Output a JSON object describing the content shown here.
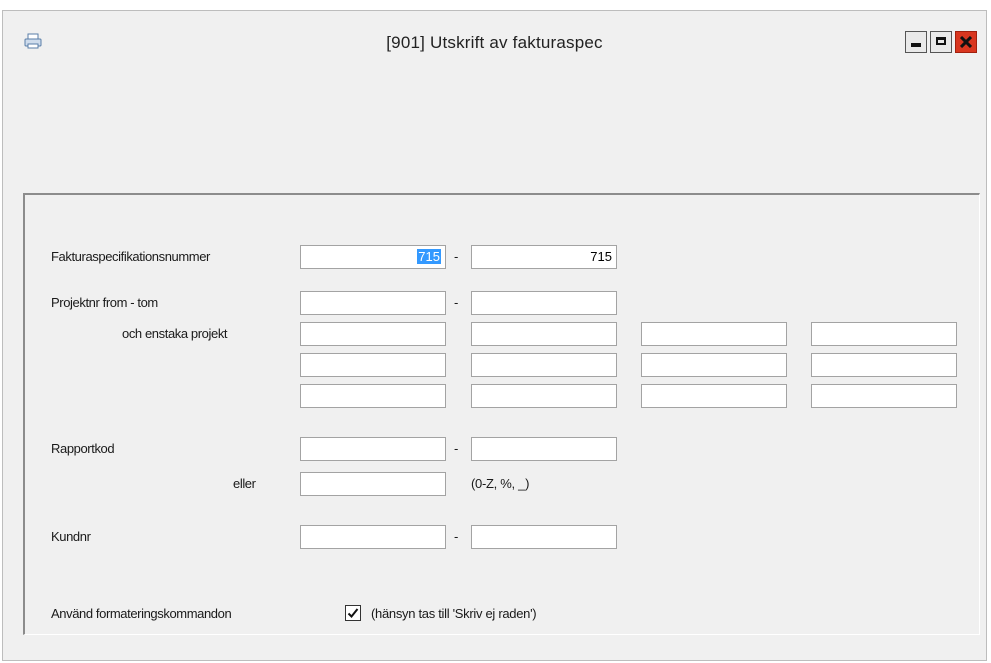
{
  "window": {
    "title": "[901]  Utskrift av fakturaspec",
    "app_icon": "printer-icon",
    "controls": [
      "minimize-icon",
      "maximize-icon",
      "close-icon"
    ]
  },
  "form": {
    "fakturaspec": {
      "label": "Fakturaspecifikationsnummer",
      "from": "715",
      "to": "715",
      "separator": "-"
    },
    "projektnr": {
      "label": "Projektnr from - tom",
      "from": "",
      "to": "",
      "separator": "-"
    },
    "enstaka": {
      "label": "och enstaka projekt",
      "fields": [
        "",
        "",
        "",
        "",
        "",
        "",
        "",
        "",
        "",
        "",
        "",
        ""
      ]
    },
    "rapportkod": {
      "label": "Rapportkod",
      "from": "",
      "to": "",
      "separator": "-",
      "or_label": "eller",
      "or_value": "",
      "hint": "(0-Z, %, _)"
    },
    "kundnr": {
      "label": "Kundnr",
      "from": "",
      "to": "",
      "separator": "-"
    },
    "formatering": {
      "label": "Använd formateringskommandon",
      "checked": true,
      "hint": "(hänsyn tas till 'Skriv ej raden')"
    }
  },
  "colors": {
    "background": "#f0f0f0",
    "selection": "#3399ff",
    "close_button": "#d9361f"
  }
}
